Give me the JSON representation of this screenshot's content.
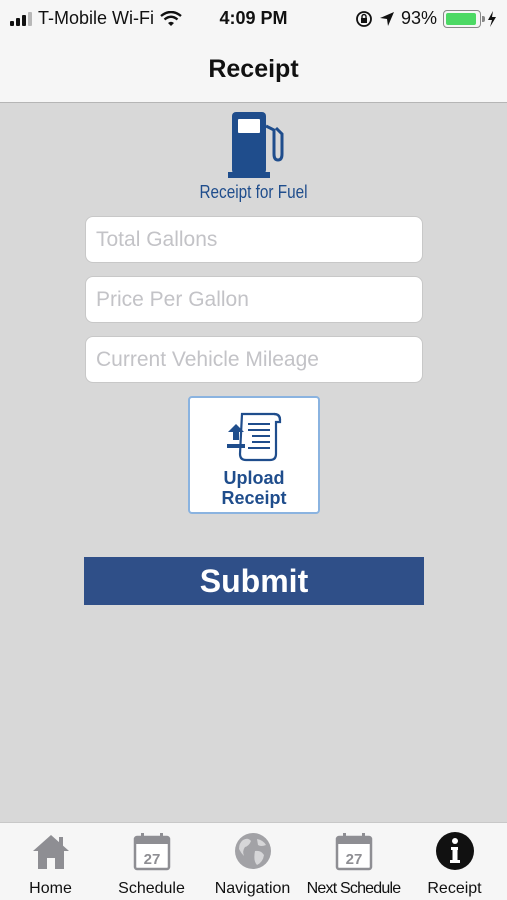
{
  "status_bar": {
    "carrier": "T-Mobile Wi-Fi",
    "time": "4:09 PM",
    "battery": "93%",
    "battery_level": 0.93
  },
  "nav": {
    "title": "Receipt"
  },
  "fuel": {
    "caption": "Receipt for Fuel"
  },
  "form": {
    "total_gallons_placeholder": "Total Gallons",
    "price_per_gallon_placeholder": "Price Per Gallon",
    "mileage_placeholder": "Current Vehicle Mileage",
    "upload_line1": "Upload",
    "upload_line2": "Receipt",
    "submit_label": "Submit"
  },
  "tabs": [
    {
      "label": "Home",
      "icon": "home-icon"
    },
    {
      "label": "Schedule",
      "icon": "calendar-icon",
      "day": "27"
    },
    {
      "label": "Navigation",
      "icon": "globe-icon"
    },
    {
      "label": "Next Schedule",
      "icon": "calendar-icon",
      "day": "27"
    },
    {
      "label": "Receipt",
      "icon": "info-icon"
    }
  ],
  "colors": {
    "brand_blue": "#1f4d8c",
    "submit_bg": "#2f4f88",
    "background": "#d8d8d8",
    "battery_green": "#4cd964"
  }
}
